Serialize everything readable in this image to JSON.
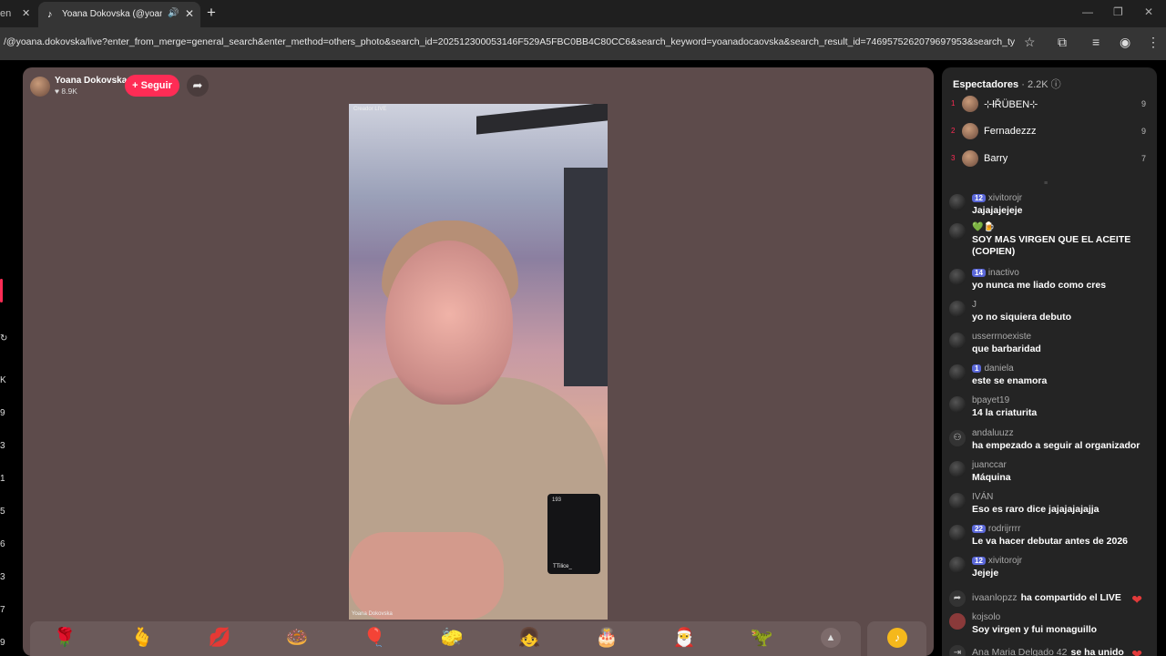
{
  "browser": {
    "prev_tab_label": "en",
    "active_tab_title": "Yoana Dokovska (@yoana.d",
    "address": "/@yoana.dokovska/live?enter_from_merge=general_search&enter_method=others_photo&search_id=202512300053146F529A5FBC0BB4C80CC6&search_keyword=yoanadocaovska&search_result_id=7469575262079697953&search_type..."
  },
  "left_strip": [
    "K",
    "9",
    "3",
    "1",
    "5",
    "6",
    "3",
    "7",
    "9"
  ],
  "host": {
    "name": "Yoana Dokovska",
    "likes": "8.9K",
    "follow_label": "+ Seguir"
  },
  "video": {
    "watermark": "Creador LIVE",
    "caption": "Yoana Dokovska",
    "mini_badge": "193",
    "mini_user": "TTilice_"
  },
  "gifts": [
    "rose-icon",
    "finger-heart-icon",
    "lips-icon",
    "donut-icon",
    "balloons-icon",
    "sponge-icon",
    "girl-icon",
    "2026-cake-icon",
    "santa-icon",
    "dino-icon"
  ],
  "viewers": {
    "title": "Espectadores",
    "count": "2.2K",
    "top": [
      {
        "rank": "1",
        "name": "⊹łŘÜBEN⊹",
        "score": "9"
      },
      {
        "rank": "2",
        "name": "Fernadezzz",
        "score": "9"
      },
      {
        "rank": "3",
        "name": "Barry",
        "score": "7"
      }
    ]
  },
  "chat": [
    {
      "user": "xivitorojr",
      "level": "12",
      "text": "Jajajajejeje"
    },
    {
      "user": "💚🍺",
      "level": "",
      "text": "SOY MAS VIRGEN QUE EL ACEITE (COPIEN)"
    },
    {
      "user": "inactivo",
      "level": "14",
      "text": "yo nunca me liado como cres"
    },
    {
      "user": "J",
      "level": "",
      "text": "yo no siquiera debuto"
    },
    {
      "user": "usserrnoexiste",
      "level": "",
      "text": "que barbaridad"
    },
    {
      "user": "daniela",
      "level": "1",
      "text": "este se enamora"
    },
    {
      "user": "bpayet19",
      "level": "",
      "text": "14 la criaturita"
    },
    {
      "user": "andaluuzz",
      "level": "",
      "text": " ha empezado a seguir al organizador"
    },
    {
      "user": "juanccar",
      "level": "",
      "text": "Máquina"
    },
    {
      "user": "IVÁN",
      "level": "",
      "text": "Eso es raro dice jajajajajajja"
    },
    {
      "user": "rodrijrrrr",
      "level": "22",
      "text": "Le va hacer debutar antes de 2026"
    },
    {
      "user": "xivitorojr",
      "level": "12",
      "text": "Jejeje"
    },
    {
      "user": "ivaanlopzz",
      "level": "",
      "text": "ha compartido el LIVE"
    },
    {
      "user": "kojsolo",
      "level": "",
      "text": "Soy virgen y fui monaguillo"
    },
    {
      "user": "Ana Maria Delgado 42",
      "level": "",
      "text": "se ha unido"
    }
  ]
}
